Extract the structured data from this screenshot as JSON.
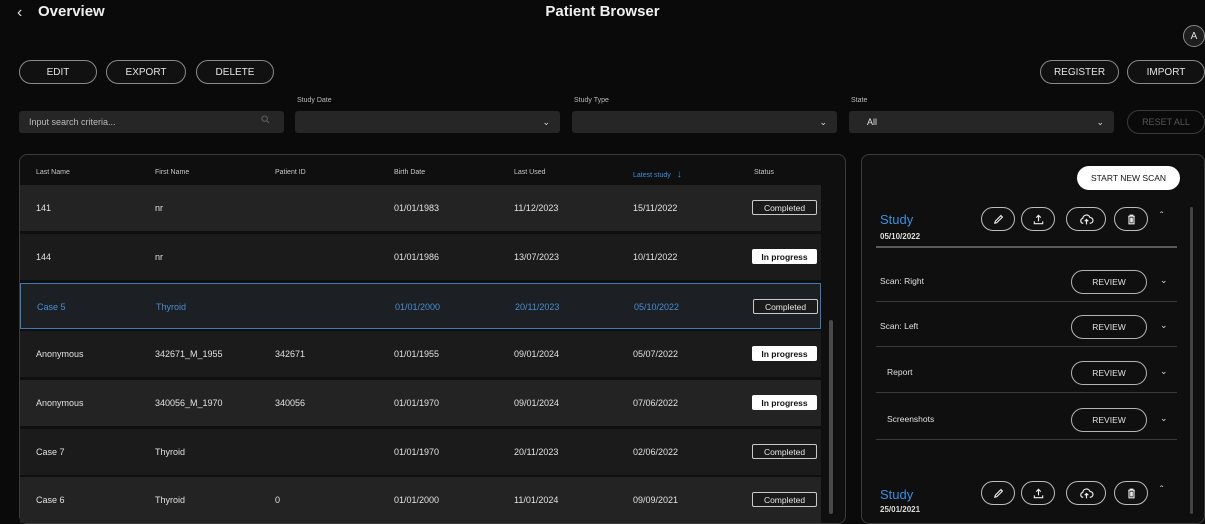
{
  "header": {
    "back_label": "Overview",
    "title": "Patient Browser",
    "avatar_initial": "A"
  },
  "toolbar": {
    "edit": "EDIT",
    "export": "EXPORT",
    "delete": "DELETE",
    "register": "REGISTER",
    "import": "IMPORT"
  },
  "filters": {
    "search_placeholder": "Input search criteria...",
    "study_date_label": "Study Date",
    "study_date_value": "",
    "study_type_label": "Study Type",
    "study_type_value": "",
    "state_label": "State",
    "state_value": "All",
    "reset_all": "RESET ALL"
  },
  "table": {
    "columns": [
      "Last Name",
      "First Name",
      "Patient ID",
      "Birth Date",
      "Last Used",
      "Latest study",
      "Status"
    ],
    "sorted_column": "Latest study",
    "rows": [
      {
        "last": "141",
        "first": "nr",
        "pid": "",
        "birth": "01/01/1983",
        "used": "11/12/2023",
        "latest": "15/11/2022",
        "status": "Completed"
      },
      {
        "last": "144",
        "first": "nr",
        "pid": "",
        "birth": "01/01/1986",
        "used": "13/07/2023",
        "latest": "10/11/2022",
        "status": "In progress"
      },
      {
        "last": "Case 5",
        "first": "Thyroid",
        "pid": "",
        "birth": "01/01/2000",
        "used": "20/11/2023",
        "latest": "05/10/2022",
        "status": "Completed"
      },
      {
        "last": "Anonymous",
        "first": "342671_M_1955",
        "pid": "342671",
        "birth": "01/01/1955",
        "used": "09/01/2024",
        "latest": "05/07/2022",
        "status": "In progress"
      },
      {
        "last": "Anonymous",
        "first": "340056_M_1970",
        "pid": "340056",
        "birth": "01/01/1970",
        "used": "09/01/2024",
        "latest": "07/06/2022",
        "status": "In progress"
      },
      {
        "last": "Case 7",
        "first": "Thyroid",
        "pid": "",
        "birth": "01/01/1970",
        "used": "20/11/2023",
        "latest": "02/06/2022",
        "status": "Completed"
      },
      {
        "last": "Case 6",
        "first": "Thyroid",
        "pid": "0",
        "birth": "01/01/2000",
        "used": "11/01/2024",
        "latest": "09/09/2021",
        "status": "Completed"
      }
    ]
  },
  "study_panel": {
    "start_new_scan": "START NEW SCAN",
    "studies": [
      {
        "title": "Study",
        "date": "05/10/2022"
      },
      {
        "title": "Study",
        "date": "25/01/2021"
      }
    ],
    "scans": [
      {
        "label": "Scan: Right",
        "action": "REVIEW"
      },
      {
        "label": "Scan: Left",
        "action": "REVIEW"
      },
      {
        "label": "Report",
        "action": "REVIEW"
      },
      {
        "label": "Screenshots",
        "action": "REVIEW"
      }
    ]
  },
  "colors": {
    "accent": "#3d8ee0",
    "background": "#0a0a0a",
    "row": "#232323"
  }
}
